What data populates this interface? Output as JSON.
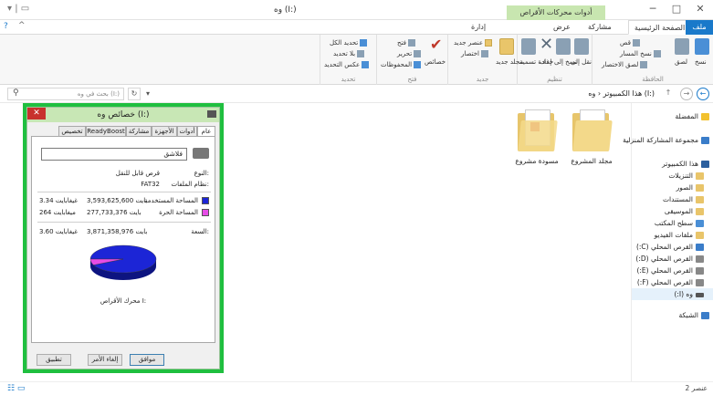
{
  "window": {
    "title": "وه (I:)",
    "tools_context": "أدوات محركات الأقراص",
    "qat": "▾ | ▭"
  },
  "ribbon_tabs": {
    "file": "ملف",
    "home": "الصفحة الرئيسية",
    "share": "مشاركة",
    "view": "عرض",
    "manage": "إدارة"
  },
  "ribbon": {
    "clipboard": {
      "label": "الحافظة",
      "copy": "نسخ",
      "paste": "لصق",
      "cut": "قص",
      "copy_path": "نسخ المسار",
      "paste_shortcut": "لصق الاختصار"
    },
    "organize": {
      "label": "تنظيم",
      "move_to": "نقل إلى",
      "copy_to": "نسخ إلى",
      "delete": "حذف",
      "rename": "إعادة تسمية"
    },
    "new": {
      "label": "جديد",
      "new_folder": "مجلد جديد",
      "new_item": "عنصر جديد",
      "easy_access": "اختصار"
    },
    "open": {
      "label": "فتح",
      "properties": "خصائص",
      "open": "فتح",
      "edit": "تحرير",
      "history": "المحفوظات"
    },
    "select": {
      "label": "تحديد",
      "select_all": "تحديد الكل",
      "select_none": "بلا تحديد",
      "invert": "عكس التحديد"
    }
  },
  "address": {
    "path": "هذا الكمبيوتر ‹ وه (I:)",
    "search_placeholder": "بحث في وه (I:)"
  },
  "nav": {
    "favorites": "المفضلة",
    "homegroup": "مجموعة المشاركة المنزلية",
    "this_pc": "هذا الكمبيوتر",
    "downloads": "التنزيلات",
    "pictures": "الصور",
    "documents": "المستندات",
    "music": "الموسيقى",
    "desktop": "سطح المكتب",
    "videos": "ملفات الفيديو",
    "drive_c": "القرص المحلي (C:)",
    "drive_d": "القرص المحلي (D:)",
    "drive_e": "القرص المحلي (E:)",
    "drive_f": "القرص المحلي (F:)",
    "drive_i": "وه (I:)",
    "network": "الشبكة"
  },
  "content": {
    "folder1": "مجلد المشروع",
    "folder2": "مسودة مشروع"
  },
  "status": {
    "count": "2 عنصر"
  },
  "dialog": {
    "title": "خصائص وه (I:)",
    "tabs": [
      "عام",
      "أدوات",
      "الأجهزة",
      "مشاركة",
      "ReadyBoost",
      "تخصيص"
    ],
    "name_value": "فلاشق",
    "type_label": "النوع:",
    "type_value": "قرص قابل للنقل",
    "fs_label": "نظام الملفات:",
    "fs_value": "FAT32",
    "used_label": "المساحة المستخدمة",
    "used_bytes": "3,593,625,600 بايت",
    "used_gb": "3.34 غيغابايت",
    "free_label": "المساحة الحرة",
    "free_bytes": "277,733,376 بايت",
    "free_gb": "264 ميغابايت",
    "cap_label": "السعة:",
    "cap_bytes": "3,871,358,976 بايت",
    "cap_gb": "3.60 غيغابايت",
    "drive_label": "محرك الأقراص I:",
    "ok": "موافق",
    "cancel": "إلغاء الأمر",
    "apply": "تطبيق",
    "colors": {
      "used": "#1c25d6",
      "free": "#e64ce6",
      "border": "#1fbf3f"
    }
  },
  "chart_data": {
    "type": "pie",
    "categories": [
      "المساحة المستخدمة",
      "المساحة الحرة"
    ],
    "values": [
      3593625600,
      277733376
    ],
    "title": "",
    "colors": [
      "#1c25d6",
      "#e64ce6"
    ]
  }
}
